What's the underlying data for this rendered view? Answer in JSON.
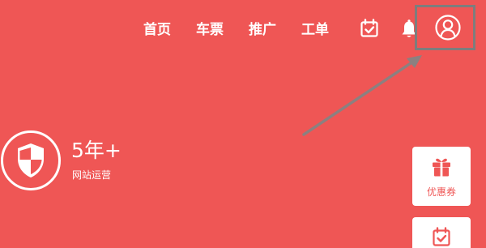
{
  "nav": {
    "items": [
      {
        "label": "首页"
      },
      {
        "label": "车票"
      },
      {
        "label": "推广"
      },
      {
        "label": "工单"
      }
    ],
    "icons": [
      "calendar-check-icon",
      "bell-icon",
      "user-avatar-icon"
    ]
  },
  "stat": {
    "value": "5年+",
    "label": "网站运营",
    "icon": "shield-icon"
  },
  "side_cards": [
    {
      "label": "优惠券",
      "icon": "gift-icon"
    },
    {
      "label": "",
      "icon": "calendar-check-icon"
    }
  ],
  "colors": {
    "background": "#ef5655",
    "foreground": "#ffffff",
    "highlight_border": "#7d7d7d",
    "annotation_arrow": "#8c8080"
  }
}
